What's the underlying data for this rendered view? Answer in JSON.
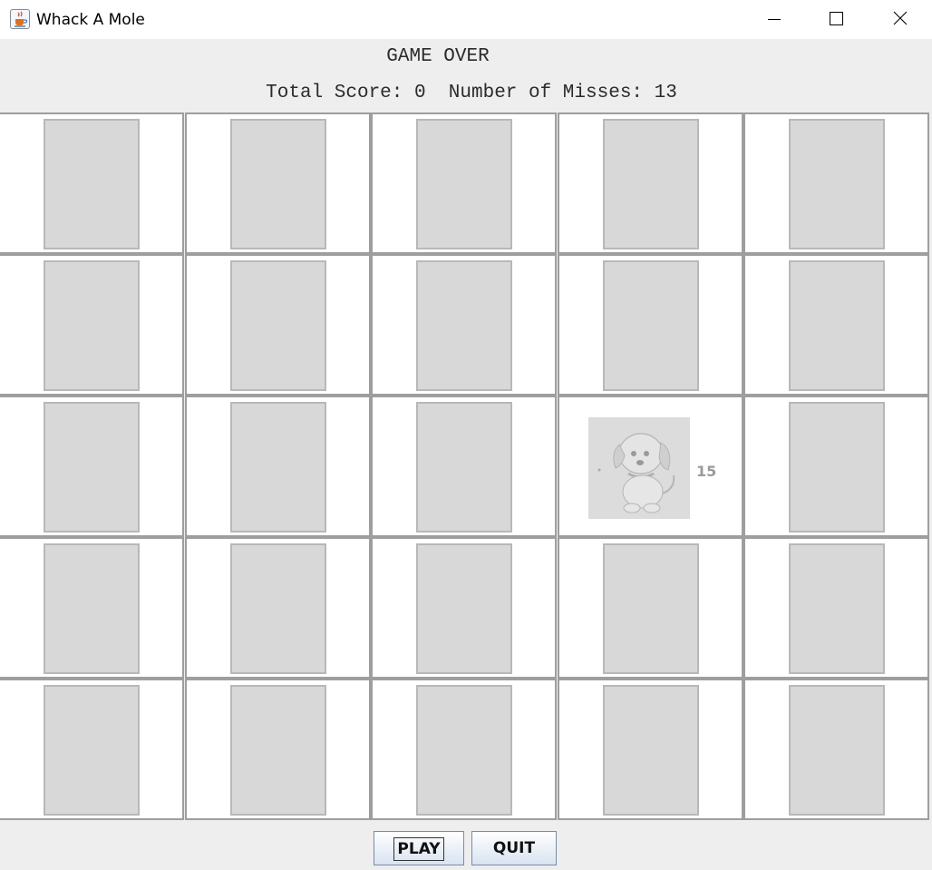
{
  "window": {
    "title": "Whack A Mole",
    "icon": "java-cup-icon"
  },
  "header": {
    "status": "GAME OVER",
    "score_line": "Total Score: 0  Number of Misses: 13"
  },
  "grid": {
    "rows": 5,
    "cols": 5,
    "active_cell": {
      "row": 3,
      "col": 4,
      "count": "15",
      "icon": "puppy-image"
    }
  },
  "buttons": {
    "play": "PLAY",
    "quit": "QUIT"
  },
  "colors": {
    "cell_bg": "#ffffff",
    "hole_fill": "#d8d8d8",
    "grid_line": "#9e9e9e",
    "panel_bg": "#eeeeee"
  }
}
